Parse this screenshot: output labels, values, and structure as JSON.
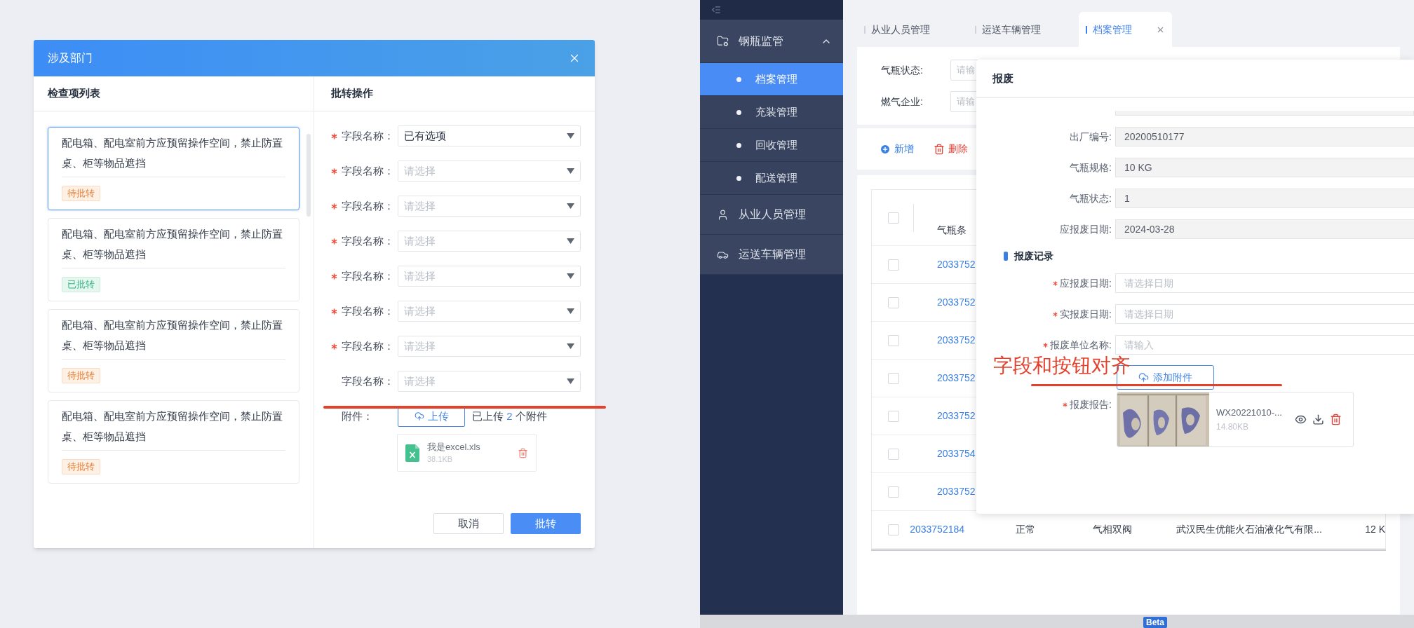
{
  "left_dialog": {
    "title": "涉及部门",
    "list_panel": {
      "title": "检查项列表",
      "items": [
        {
          "text": "配电箱、配电室前方应预留操作空间，禁止防置桌、柜等物品遮挡",
          "status": "待批转",
          "kind": "pending",
          "selected": true
        },
        {
          "text": "配电箱、配电室前方应预留操作空间，禁止防置桌、柜等物品遮挡",
          "status": "已批转",
          "kind": "done",
          "selected": false
        },
        {
          "text": "配电箱、配电室前方应预留操作空间，禁止防置桌、柜等物品遮挡",
          "status": "待批转",
          "kind": "pending",
          "selected": false
        },
        {
          "text": "配电箱、配电室前方应预留操作空间，禁止防置桌、柜等物品遮挡",
          "status": "待批转",
          "kind": "pending",
          "selected": false
        }
      ]
    },
    "form_panel": {
      "title": "批转操作",
      "fields": [
        {
          "label": "字段名称：",
          "required": true,
          "value": "已有选项"
        },
        {
          "label": "字段名称：",
          "required": true,
          "placeholder": "请选择"
        },
        {
          "label": "字段名称：",
          "required": true,
          "placeholder": "请选择"
        },
        {
          "label": "字段名称：",
          "required": true,
          "placeholder": "请选择"
        },
        {
          "label": "字段名称：",
          "required": true,
          "placeholder": "请选择"
        },
        {
          "label": "字段名称：",
          "required": true,
          "placeholder": "请选择"
        },
        {
          "label": "字段名称：",
          "required": true,
          "placeholder": "请选择"
        },
        {
          "label": "字段名称：",
          "required": false,
          "placeholder": "请选择"
        }
      ],
      "attachment": {
        "label": "附件：",
        "upload_button": "上传",
        "summary": {
          "before": "已上传",
          "count": "2",
          "after": "个附件"
        },
        "files": [
          {
            "name": "我是excel.xls",
            "size": "38.1KB"
          }
        ]
      },
      "buttons": [
        {
          "label": "取消",
          "kind": "secondary"
        },
        {
          "label": "批转",
          "kind": "primary"
        }
      ]
    }
  },
  "app": {
    "sidebar": {
      "menu": [
        {
          "label": "钢瓶监管",
          "expanded": true,
          "children": [
            {
              "label": "档案管理",
              "selected": true
            },
            {
              "label": "充装管理",
              "selected": false
            },
            {
              "label": "回收管理",
              "selected": false
            },
            {
              "label": "配送管理",
              "selected": false
            }
          ]
        },
        {
          "label": "从业人员管理"
        },
        {
          "label": "运送车辆管理"
        }
      ]
    },
    "tabs": [
      {
        "label": "从业人员管理",
        "selected": false
      },
      {
        "label": "运送车辆管理",
        "selected": false
      },
      {
        "label": "档案管理",
        "selected": true
      }
    ],
    "filters": [
      {
        "label": "气瓶状态:",
        "placeholder": "请输"
      },
      {
        "label": "燃气企业:",
        "placeholder": "请输"
      }
    ],
    "toolbar": [
      {
        "label": "新增",
        "kind": "add"
      },
      {
        "label": "删除",
        "kind": "delete"
      }
    ],
    "table": {
      "header_checked": false,
      "columns": [
        "气瓶条"
      ],
      "rows": [
        {
          "checked": false,
          "cells": [
            "2033752"
          ]
        },
        {
          "checked": false,
          "cells": [
            "2033752"
          ]
        },
        {
          "checked": false,
          "cells": [
            "2033752"
          ]
        },
        {
          "checked": false,
          "cells": [
            "2033752"
          ]
        },
        {
          "checked": false,
          "cells": [
            "2033752"
          ]
        },
        {
          "checked": false,
          "cells": [
            "2033754"
          ]
        },
        {
          "checked": false,
          "cells": [
            "2033752"
          ]
        },
        {
          "checked": false,
          "cells": [
            "2033752184",
            "正常",
            "气相双阀",
            "武汉民生优能火石油液化气有限...",
            "12 K"
          ]
        }
      ]
    },
    "modal": {
      "title": "报废",
      "fields": [
        {
          "label": "出厂编号:",
          "value": "20200510177"
        },
        {
          "label": "气瓶规格:",
          "value": "10 KG"
        },
        {
          "label": "气瓶状态:",
          "value": "1"
        },
        {
          "label": "应报废日期:",
          "value": "2024-03-28"
        }
      ],
      "section": "报废记录",
      "record_fields": [
        {
          "label": "应报废日期:",
          "required": true,
          "placeholder": "请选择日期"
        },
        {
          "label": "实报废日期:",
          "required": true,
          "placeholder": "请选择日期"
        },
        {
          "label": "报废单位名称:",
          "required": true,
          "placeholder": "请输入"
        }
      ],
      "attachment_button": "添加附件",
      "report": {
        "label": "报废报告:",
        "required": true,
        "file": {
          "name": "WX20221010-...",
          "size": "14.80KB"
        }
      }
    },
    "annotation": "字段和按钮对齐",
    "badge": "Beta"
  }
}
